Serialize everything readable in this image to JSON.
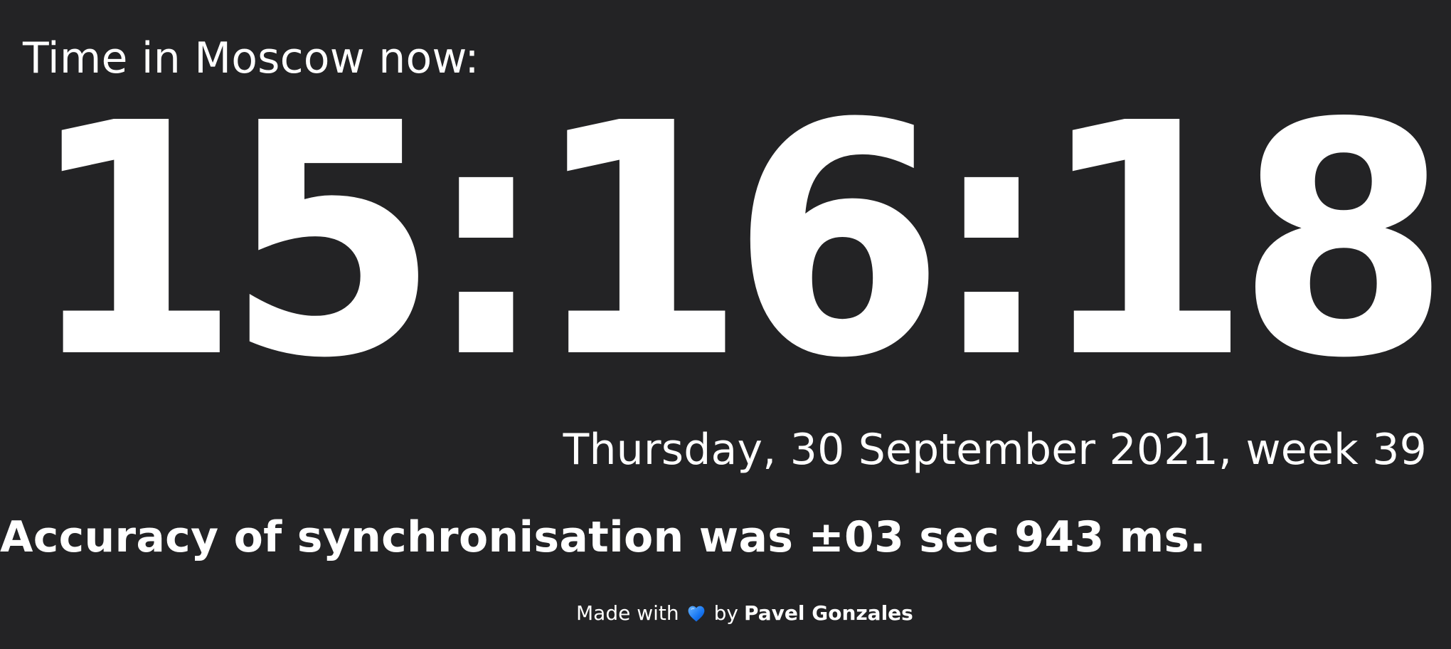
{
  "header": {
    "title": "Time in Moscow now:"
  },
  "clock": {
    "time": "15:16:18"
  },
  "date": {
    "text": "Thursday, 30 September 2021, week 39"
  },
  "sync": {
    "text": "Accuracy of synchronisation was ±03 sec 943 ms."
  },
  "footer": {
    "made_with": "Made with",
    "heart_icon": "blue-heart-icon",
    "by_text": "by",
    "author": "Pavel Gonzales"
  },
  "colors": {
    "background": "#232325",
    "text": "#ffffff",
    "heart": "#1877f2"
  }
}
